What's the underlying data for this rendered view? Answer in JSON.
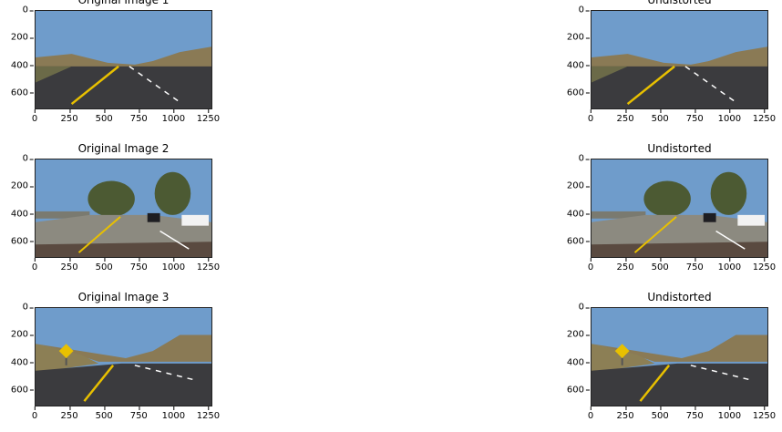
{
  "panels": [
    {
      "title": "Original Image 1",
      "scene": "highway"
    },
    {
      "title": "Undistorted",
      "scene": "highway"
    },
    {
      "title": "Original Image 2",
      "scene": "trees"
    },
    {
      "title": "Undistorted",
      "scene": "trees"
    },
    {
      "title": "Original Image 3",
      "scene": "sign"
    },
    {
      "title": "Undistorted",
      "scene": "sign"
    }
  ],
  "axes": {
    "yticks": [
      "0",
      "200",
      "400",
      "600"
    ],
    "xticks": [
      "0",
      "250",
      "500",
      "750",
      "1000",
      "1250"
    ],
    "y_range": [
      0,
      720
    ],
    "x_range": [
      0,
      1280
    ]
  },
  "colors": {
    "sky": "#6f9ccb",
    "road": "#3b3b3e",
    "lane_yellow": "#e8c000",
    "lane_white": "#ffffff",
    "hills": "#8a7a55",
    "trees": "#4c5a33"
  }
}
